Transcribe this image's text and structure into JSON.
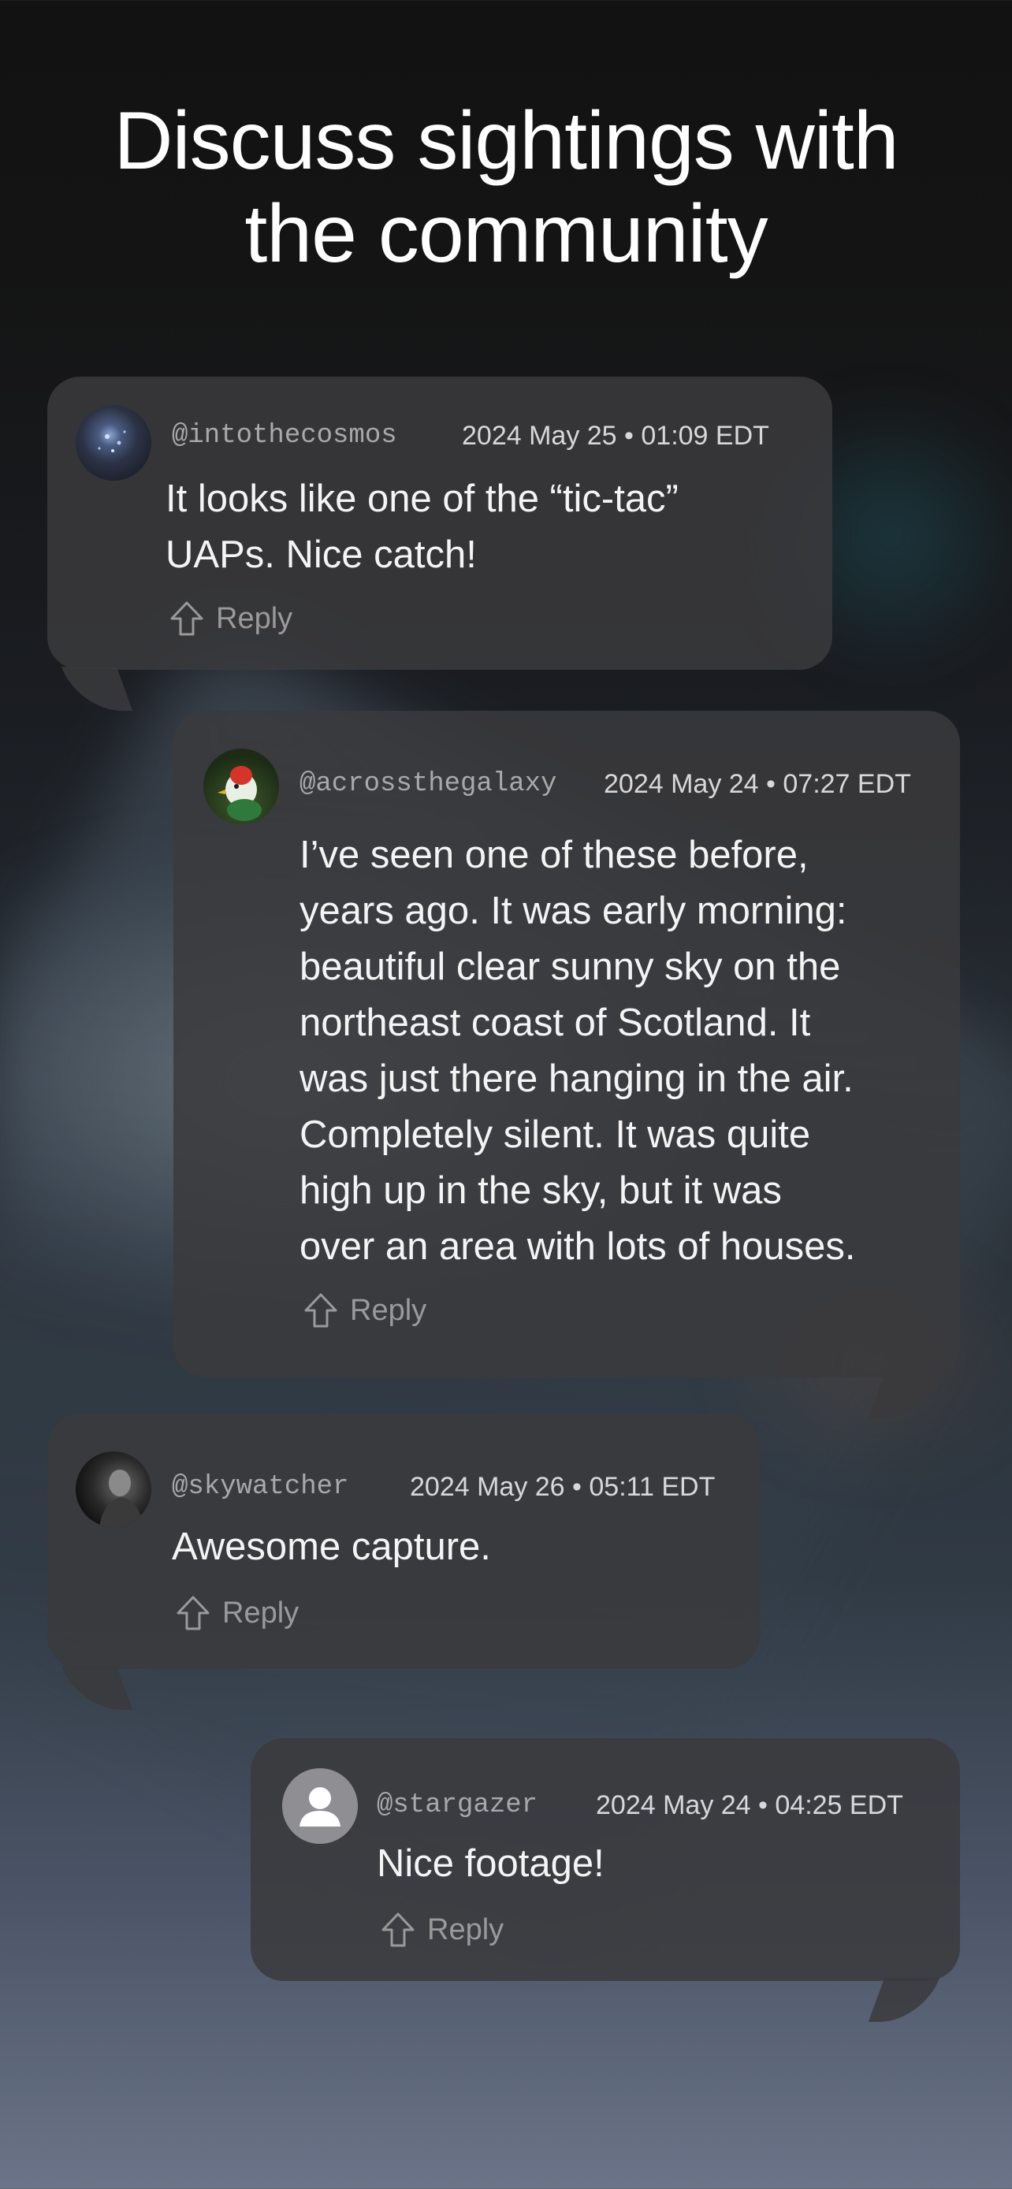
{
  "headline": {
    "line1": "Discuss sightings with",
    "line2": "the community"
  },
  "comments": [
    {
      "handle": "@intothecosmos",
      "date": "2024 May 25 • 01:09 EDT",
      "body": [
        "It looks like one of the “tic-tac”",
        "UAPs.  Nice catch!"
      ],
      "reply_label": "Reply",
      "avatar": "galaxy-avatar"
    },
    {
      "handle": "@acrossthegalaxy",
      "date": "2024 May 24 • 07:27 EDT",
      "body": [
        "I’ve seen one of these before,",
        "years ago. It was early morning:",
        "beautiful clear sunny sky on the",
        "northeast coast of Scotland. It",
        "was just there hanging in the air.",
        "Completely silent. It was quite",
        "high up in the sky, but it was",
        "over an area with lots of houses."
      ],
      "reply_label": "Reply",
      "avatar": "bird-avatar"
    },
    {
      "handle": "@skywatcher",
      "date": "2024 May 26 • 05:11 EDT",
      "body": [
        "Awesome capture."
      ],
      "reply_label": "Reply",
      "avatar": "portrait-avatar"
    },
    {
      "handle": "@stargazer",
      "date": "2024 May 24 • 04:25 EDT",
      "body": [
        "Nice footage!"
      ],
      "reply_label": "Reply",
      "avatar": "default-person-avatar"
    }
  ],
  "colors": {
    "bubble": "#3a3a3c",
    "text": "#f4f4f4",
    "muted": "#9a9a9c",
    "handle": "#a9a9ab"
  }
}
